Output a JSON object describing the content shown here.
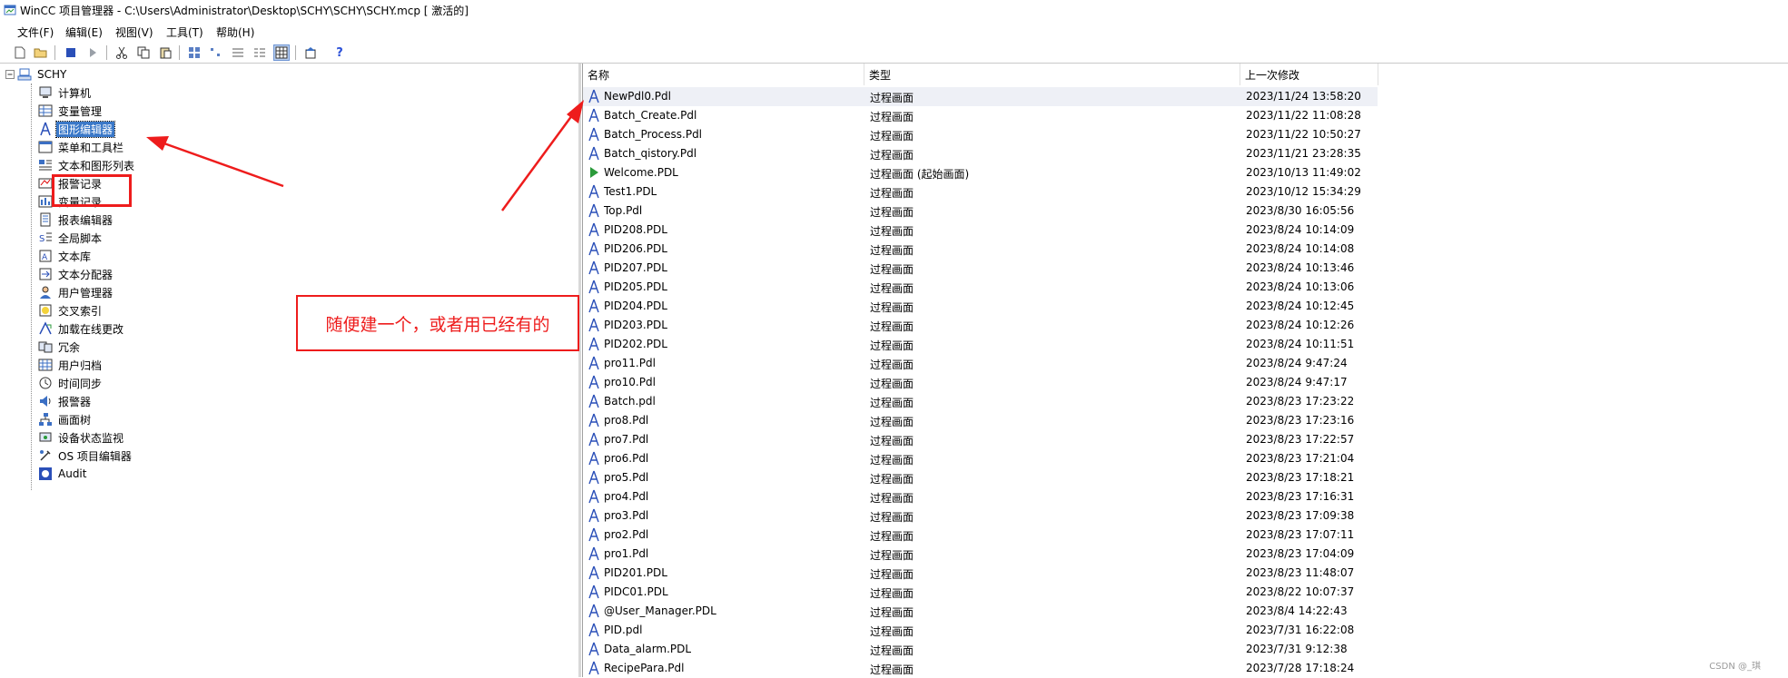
{
  "window": {
    "title": "WinCC 项目管理器 - C:\\Users\\Administrator\\Desktop\\SCHY\\SCHY\\SCHY.mcp [ 激活的]"
  },
  "menu": [
    "文件(F)",
    "编辑(E)",
    "视图(V)",
    "工具(T)",
    "帮助(H)"
  ],
  "tree": {
    "root": "SCHY",
    "items": [
      {
        "label": "计算机",
        "icon": "computer-icon"
      },
      {
        "label": "变量管理",
        "icon": "tag-management-icon"
      },
      {
        "label": "图形编辑器",
        "icon": "graphics-designer-icon",
        "selected": true
      },
      {
        "label": "菜单和工具栏",
        "icon": "menu-toolbar-icon"
      },
      {
        "label": "文本和图形列表",
        "icon": "text-graphic-list-icon"
      },
      {
        "label": "报警记录",
        "icon": "alarm-logging-icon"
      },
      {
        "label": "变量记录",
        "icon": "tag-logging-icon"
      },
      {
        "label": "报表编辑器",
        "icon": "report-designer-icon"
      },
      {
        "label": "全局脚本",
        "icon": "global-script-icon"
      },
      {
        "label": "文本库",
        "icon": "text-library-icon"
      },
      {
        "label": "文本分配器",
        "icon": "text-distributor-icon"
      },
      {
        "label": "用户管理器",
        "icon": "user-administrator-icon"
      },
      {
        "label": "交叉索引",
        "icon": "cross-reference-icon"
      },
      {
        "label": "加载在线更改",
        "icon": "load-online-changes-icon"
      },
      {
        "label": "冗余",
        "icon": "redundancy-icon"
      },
      {
        "label": "用户归档",
        "icon": "user-archive-icon"
      },
      {
        "label": "时间同步",
        "icon": "time-sync-icon"
      },
      {
        "label": "报警器",
        "icon": "horn-icon"
      },
      {
        "label": "画面树",
        "icon": "picture-tree-icon"
      },
      {
        "label": "设备状态监视",
        "icon": "device-status-icon"
      },
      {
        "label": "OS 项目编辑器",
        "icon": "os-project-editor-icon"
      },
      {
        "label": "Audit",
        "icon": "audit-icon"
      }
    ]
  },
  "annotation": {
    "callout_text": "随便建一个，或者用已经有的",
    "color": "#ee1c1c"
  },
  "list": {
    "columns": [
      "名称",
      "类型",
      "上一次修改"
    ],
    "rows": [
      {
        "name": "NewPdl0.Pdl",
        "type": "过程画面",
        "modified": "2023/11/24 13:58:20",
        "icon": "picture-file-icon"
      },
      {
        "name": "Batch_Create.Pdl",
        "type": "过程画面",
        "modified": "2023/11/22 11:08:28",
        "icon": "picture-file-icon"
      },
      {
        "name": "Batch_Process.Pdl",
        "type": "过程画面",
        "modified": "2023/11/22 10:50:27",
        "icon": "picture-file-icon"
      },
      {
        "name": "Batch_qistory.Pdl",
        "type": "过程画面",
        "modified": "2023/11/21 23:28:35",
        "icon": "picture-file-icon"
      },
      {
        "name": "Welcome.PDL",
        "type": "过程画面 (起始画面)",
        "modified": "2023/10/13 11:49:02",
        "icon": "start-picture-icon"
      },
      {
        "name": "Test1.PDL",
        "type": "过程画面",
        "modified": "2023/10/12 15:34:29",
        "icon": "picture-file-icon"
      },
      {
        "name": "Top.Pdl",
        "type": "过程画面",
        "modified": "2023/8/30 16:05:56",
        "icon": "picture-file-icon"
      },
      {
        "name": "PID208.PDL",
        "type": "过程画面",
        "modified": "2023/8/24 10:14:09",
        "icon": "picture-file-icon"
      },
      {
        "name": "PID206.PDL",
        "type": "过程画面",
        "modified": "2023/8/24 10:14:08",
        "icon": "picture-file-icon"
      },
      {
        "name": "PID207.PDL",
        "type": "过程画面",
        "modified": "2023/8/24 10:13:46",
        "icon": "picture-file-icon"
      },
      {
        "name": "PID205.PDL",
        "type": "过程画面",
        "modified": "2023/8/24 10:13:06",
        "icon": "picture-file-icon"
      },
      {
        "name": "PID204.PDL",
        "type": "过程画面",
        "modified": "2023/8/24 10:12:45",
        "icon": "picture-file-icon"
      },
      {
        "name": "PID203.PDL",
        "type": "过程画面",
        "modified": "2023/8/24 10:12:26",
        "icon": "picture-file-icon"
      },
      {
        "name": "PID202.PDL",
        "type": "过程画面",
        "modified": "2023/8/24 10:11:51",
        "icon": "picture-file-icon"
      },
      {
        "name": "pro11.Pdl",
        "type": "过程画面",
        "modified": "2023/8/24 9:47:24",
        "icon": "picture-file-icon"
      },
      {
        "name": "pro10.Pdl",
        "type": "过程画面",
        "modified": "2023/8/24 9:47:17",
        "icon": "picture-file-icon"
      },
      {
        "name": "Batch.pdl",
        "type": "过程画面",
        "modified": "2023/8/23 17:23:22",
        "icon": "picture-file-icon"
      },
      {
        "name": "pro8.Pdl",
        "type": "过程画面",
        "modified": "2023/8/23 17:23:16",
        "icon": "picture-file-icon"
      },
      {
        "name": "pro7.Pdl",
        "type": "过程画面",
        "modified": "2023/8/23 17:22:57",
        "icon": "picture-file-icon"
      },
      {
        "name": "pro6.Pdl",
        "type": "过程画面",
        "modified": "2023/8/23 17:21:04",
        "icon": "picture-file-icon"
      },
      {
        "name": "pro5.Pdl",
        "type": "过程画面",
        "modified": "2023/8/23 17:18:21",
        "icon": "picture-file-icon"
      },
      {
        "name": "pro4.Pdl",
        "type": "过程画面",
        "modified": "2023/8/23 17:16:31",
        "icon": "picture-file-icon"
      },
      {
        "name": "pro3.Pdl",
        "type": "过程画面",
        "modified": "2023/8/23 17:09:38",
        "icon": "picture-file-icon"
      },
      {
        "name": "pro2.Pdl",
        "type": "过程画面",
        "modified": "2023/8/23 17:07:11",
        "icon": "picture-file-icon"
      },
      {
        "name": "pro1.Pdl",
        "type": "过程画面",
        "modified": "2023/8/23 17:04:09",
        "icon": "picture-file-icon"
      },
      {
        "name": "PID201.PDL",
        "type": "过程画面",
        "modified": "2023/8/23 11:48:07",
        "icon": "picture-file-icon"
      },
      {
        "name": "PIDC01.PDL",
        "type": "过程画面",
        "modified": "2023/8/22 10:07:37",
        "icon": "picture-file-icon"
      },
      {
        "name": "@User_Manager.PDL",
        "type": "过程画面",
        "modified": "2023/8/4 14:22:43",
        "icon": "picture-file-icon"
      },
      {
        "name": "PID.pdl",
        "type": "过程画面",
        "modified": "2023/7/31 16:22:08",
        "icon": "picture-file-icon"
      },
      {
        "name": "Data_alarm.PDL",
        "type": "过程画面",
        "modified": "2023/7/31 9:12:38",
        "icon": "picture-file-icon"
      },
      {
        "name": "RecipePara.Pdl",
        "type": "过程画面",
        "modified": "2023/7/28 17:18:24",
        "icon": "picture-file-icon"
      }
    ]
  },
  "watermark": "CSDN @_琪"
}
